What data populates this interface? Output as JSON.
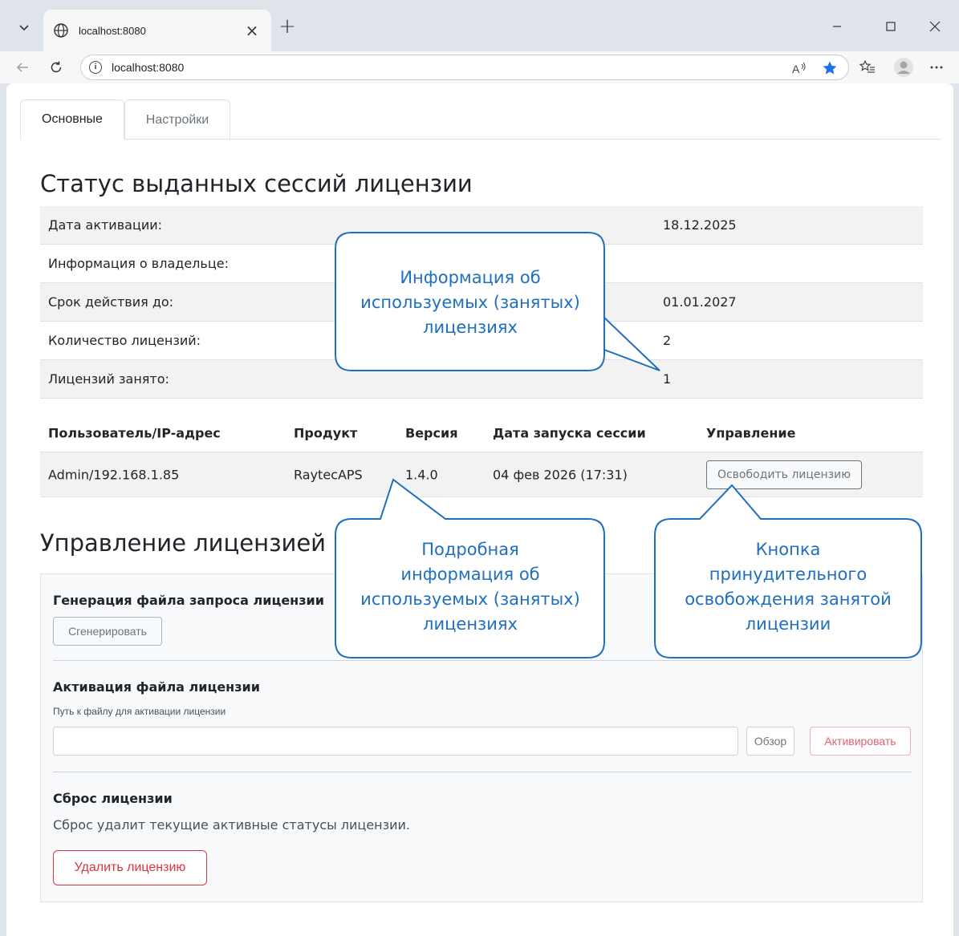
{
  "browser": {
    "tab_title": "localhost:8080",
    "url": "localhost:8080"
  },
  "tabs": [
    {
      "label": "Основные",
      "active": true
    },
    {
      "label": "Настройки",
      "active": false
    }
  ],
  "status": {
    "heading": "Статус выданных сессий лицензии",
    "rows": [
      {
        "label": "Дата активации:",
        "value": "18.12.2025"
      },
      {
        "label": "Информация о владельце:",
        "value": ""
      },
      {
        "label": "Срок действия до:",
        "value": "01.01.2027"
      },
      {
        "label": "Количество лицензий:",
        "value": "2"
      },
      {
        "label": "Лицензий занято:",
        "value": "1"
      }
    ]
  },
  "sessions": {
    "headers": [
      "Пользователь/IP-адрес",
      "Продукт",
      "Версия",
      "Дата запуска сессии",
      "Управление"
    ],
    "rows": [
      {
        "user": "Admin/192.168.1.85",
        "product": "RaytecAPS",
        "version": "1.4.0",
        "date": "04 фев 2026 (17:31)",
        "action": "Освободить лицензию"
      }
    ]
  },
  "management": {
    "heading": "Управление лицензией",
    "generate": {
      "title": "Генерация файла запроса лицензии",
      "button": "Сгенерировать"
    },
    "activate": {
      "title": "Активация файла лицензии",
      "label": "Путь к файлу для активации лицензии",
      "input_value": "",
      "browse": "Обзор",
      "button": "Активировать"
    },
    "reset": {
      "title": "Сброс лицензии",
      "text": "Сброс удалит текущие активные статусы лицензии.",
      "button": "Удалить лицензию"
    }
  },
  "callouts": {
    "top": "Информация об\nиспользуемых (занятых)\nлицензиях",
    "bottom_left": "Подробная\nинформация об\nиспользуемых (занятых)\nлицензиях",
    "bottom_right": "Кнопка\nпринудительного\nосвобождения занятой\nлицензии"
  },
  "colors": {
    "callout_border": "#1f6fbf",
    "danger": "#dc3545",
    "favorite_star": "#1a73e8"
  },
  "icons": [
    "tab-dropdown-icon",
    "globe-icon",
    "close-icon",
    "plus-icon",
    "minimize-icon",
    "maximize-icon",
    "back-icon",
    "reload-icon",
    "info-icon",
    "read-aloud-icon",
    "star-icon",
    "favorites-icon",
    "profile-icon",
    "more-icon"
  ]
}
